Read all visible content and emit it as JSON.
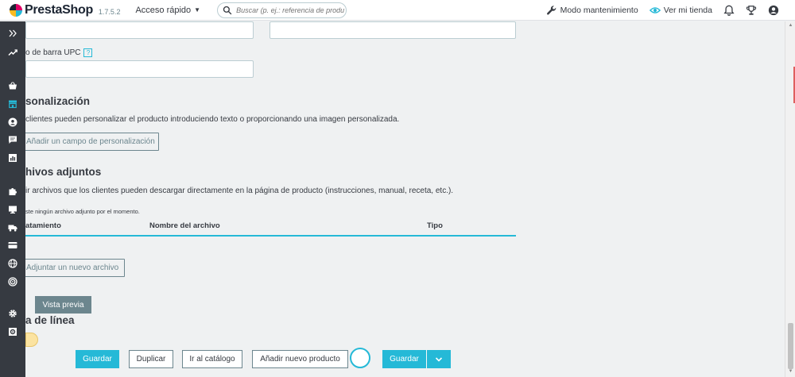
{
  "header": {
    "logo_text": "PrestaShop",
    "version": "1.7.5.2",
    "quick_access": "Acceso rápido",
    "search_placeholder": "Buscar (p. ej.: referencia de producto, no",
    "maintenance": "Modo mantenimiento",
    "view_store": "Ver mi tienda"
  },
  "sidebar": {
    "icons": [
      "expand-icon",
      "stats-trend-icon",
      "basket-icon",
      "store-icon",
      "customer-icon",
      "messages-icon",
      "reports-icon",
      "modules-icon",
      "design-icon",
      "shipping-icon",
      "payment-icon",
      "international-icon",
      "theme-icon",
      "settings-icon",
      "advanced-icon"
    ]
  },
  "form": {
    "upc_label": "Código de barra UPC",
    "upc_label_visible": "o de barra UPC",
    "help_mark": "?",
    "personalization_title": "sonalización",
    "personalization_desc": "clientes pueden personalizar el producto introduciendo texto o proporcionando una imagen personalizada.",
    "add_field_button": "Añadir un campo de personalización",
    "attachments_title": "hivos adjuntos",
    "attachments_desc": "ir archivos que los clientes pueden descargar directamente en la página de producto (instrucciones, manual, receta, etc.).",
    "no_attachments": "ste ningún archivo adjunto por el momento.",
    "table_headers": {
      "col1": "atamiento",
      "col2": "Nombre del archivo",
      "col3": "Tipo"
    },
    "attach_button": "Adjuntar un nuevo archivo",
    "preview_button": "Vista previa",
    "online_title": "a de línea"
  },
  "footer": {
    "save": "Guardar",
    "duplicate": "Duplicar",
    "catalog": "Ir al catálogo",
    "new_product": "Añadir nuevo producto",
    "save_split": "Guardar"
  },
  "colors": {
    "primary": "#25b9d7",
    "sidebar": "#363a41",
    "secondary": "#6c868e",
    "background": "#eff1f2"
  }
}
